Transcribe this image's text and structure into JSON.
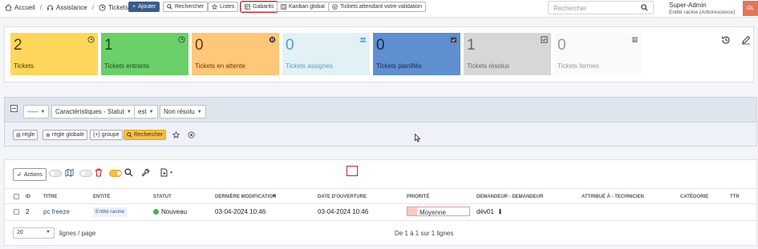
{
  "breadcrumb": {
    "home": "Accueil",
    "assistance": "Assistance",
    "tickets": "Tickets"
  },
  "toolbar": {
    "add": "Ajouter",
    "search": "Rechercher",
    "lists": "Listes",
    "templates": "Gabarits",
    "kanban": "Kanban global",
    "validation": "Tickets attendant votre validation"
  },
  "search": {
    "placeholder": "Rechercher"
  },
  "user": {
    "name": "Super-Admin",
    "entity": "Entité racine (Arborescence)",
    "initials": "GL"
  },
  "stats": [
    {
      "count": "2",
      "label": "Tickets",
      "color": "#ffd65c",
      "text": "#4b3d05",
      "icon": "clock-icon"
    },
    {
      "count": "1",
      "label": "Tickets entrants",
      "color": "#6bd06a",
      "text": "#1e4a1e",
      "icon": "clock-icon"
    },
    {
      "count": "0",
      "label": "Tickets en attente",
      "color": "#ffc77a",
      "text": "#6a3e00",
      "icon": "pause-icon"
    },
    {
      "count": "0",
      "label": "Tickets assignés",
      "color": "#e2f1f5",
      "text": "#4ea3c7",
      "icon": "users-icon"
    },
    {
      "count": "0",
      "label": "Tickets planifiés",
      "color": "#5f8fcf",
      "text": "#1a2a45",
      "icon": "calendar-icon"
    },
    {
      "count": "1",
      "label": "Tickets résolus",
      "color": "#d7d7d7",
      "text": "#666666",
      "icon": "check-square-icon"
    },
    {
      "count": "0",
      "label": "Tickets fermés",
      "color": "#fafafa",
      "text": "#999999",
      "icon": "archive-icon"
    }
  ],
  "filter": {
    "link_value": "-----",
    "field": "Caractéristiques - Statut",
    "operator": "est",
    "value": "Non résolu",
    "add_rule": "règle",
    "add_global_rule": "règle globale",
    "add_group": "groupe",
    "search_button": "Rechercher"
  },
  "table": {
    "actions_label": "Actions",
    "columns": [
      "ID",
      "TITRE",
      "ENTITÉ",
      "STATUT",
      "DERNIÈRE MODIFICATION",
      "DATE D'OUVERTURE",
      "PRIORITÉ",
      "DEMANDEUR - DEMANDEUR",
      "ATTRIBUÉ À - TECHNICIEN",
      "CATÉGORIE",
      "TTR"
    ],
    "rows": [
      {
        "id": "2",
        "title": "pc freeze",
        "entity": "Entité racine",
        "status": "Nouveau",
        "last_modified": "03-04-2024 10:46",
        "opened": "03-04-2024 10:46",
        "priority": "Moyenne",
        "requester": "dév01",
        "technician": "",
        "category": "",
        "ttr": ""
      }
    ],
    "page_size": "20",
    "page_size_label": "lignes / page",
    "pagination_info": "De 1 à 1 sur 1 lignes"
  }
}
